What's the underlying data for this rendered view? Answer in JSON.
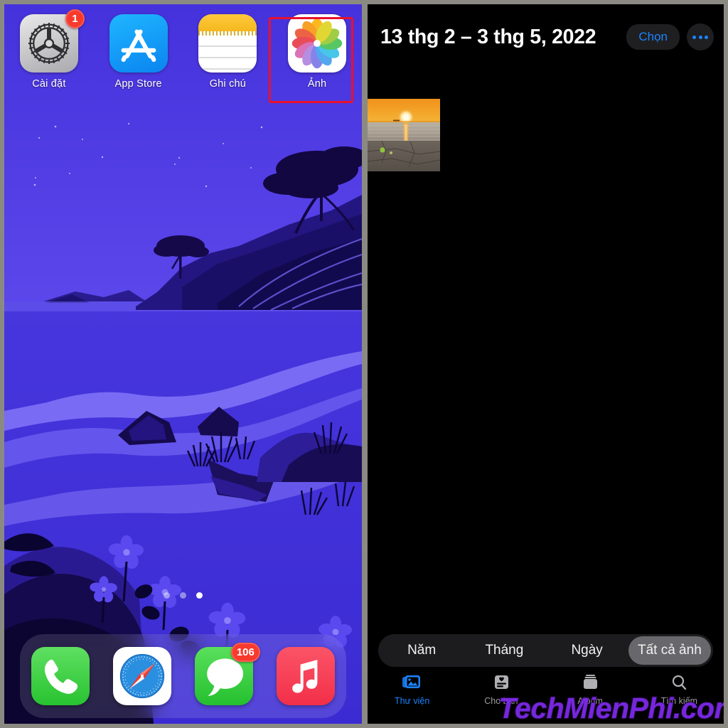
{
  "home_screen": {
    "apps": [
      {
        "label": "Cài đặt",
        "icon": "settings-gear-icon",
        "badge": "1"
      },
      {
        "label": "App Store",
        "icon": "app-store-icon",
        "badge": null
      },
      {
        "label": "Ghi chú",
        "icon": "notes-icon",
        "badge": null
      },
      {
        "label": "Ảnh",
        "icon": "photos-flower-icon",
        "badge": null,
        "highlighted": true
      }
    ],
    "page_dots": {
      "count": 3,
      "active_index": 2
    },
    "dock": [
      {
        "label": "Phone",
        "icon": "phone-icon",
        "badge": null
      },
      {
        "label": "Safari",
        "icon": "safari-compass-icon",
        "badge": null
      },
      {
        "label": "Messages",
        "icon": "messages-bubble-icon",
        "badge": "106"
      },
      {
        "label": "Music",
        "icon": "music-note-icon",
        "badge": null
      }
    ],
    "highlight_color": "#e8112d"
  },
  "photos_app": {
    "header": {
      "title": "13 thg 2 – 3 thg 5, 2022",
      "select_label": "Chọn",
      "more_icon": "ellipsis-icon",
      "accent_color": "#1a84ff"
    },
    "grid": {
      "photos": [
        {
          "name": "sunset-beach-photo"
        }
      ]
    },
    "segmented_control": {
      "options": [
        "Năm",
        "Tháng",
        "Ngày",
        "Tất cả ảnh"
      ],
      "selected": "Tất cả ảnh",
      "selected_index": 3
    },
    "tab_bar": {
      "tabs": [
        {
          "label": "Thư viện",
          "icon": "library-photos-icon",
          "active": true
        },
        {
          "label": "Cho bạn",
          "icon": "for-you-card-icon",
          "active": false
        },
        {
          "label": "Album",
          "icon": "albums-stack-icon",
          "active": false
        },
        {
          "label": "Tìm kiếm",
          "icon": "search-magnifier-icon",
          "active": false
        }
      ]
    }
  },
  "watermark": {
    "text": "TechMienPhi.com",
    "color": "#7d2ae8"
  }
}
